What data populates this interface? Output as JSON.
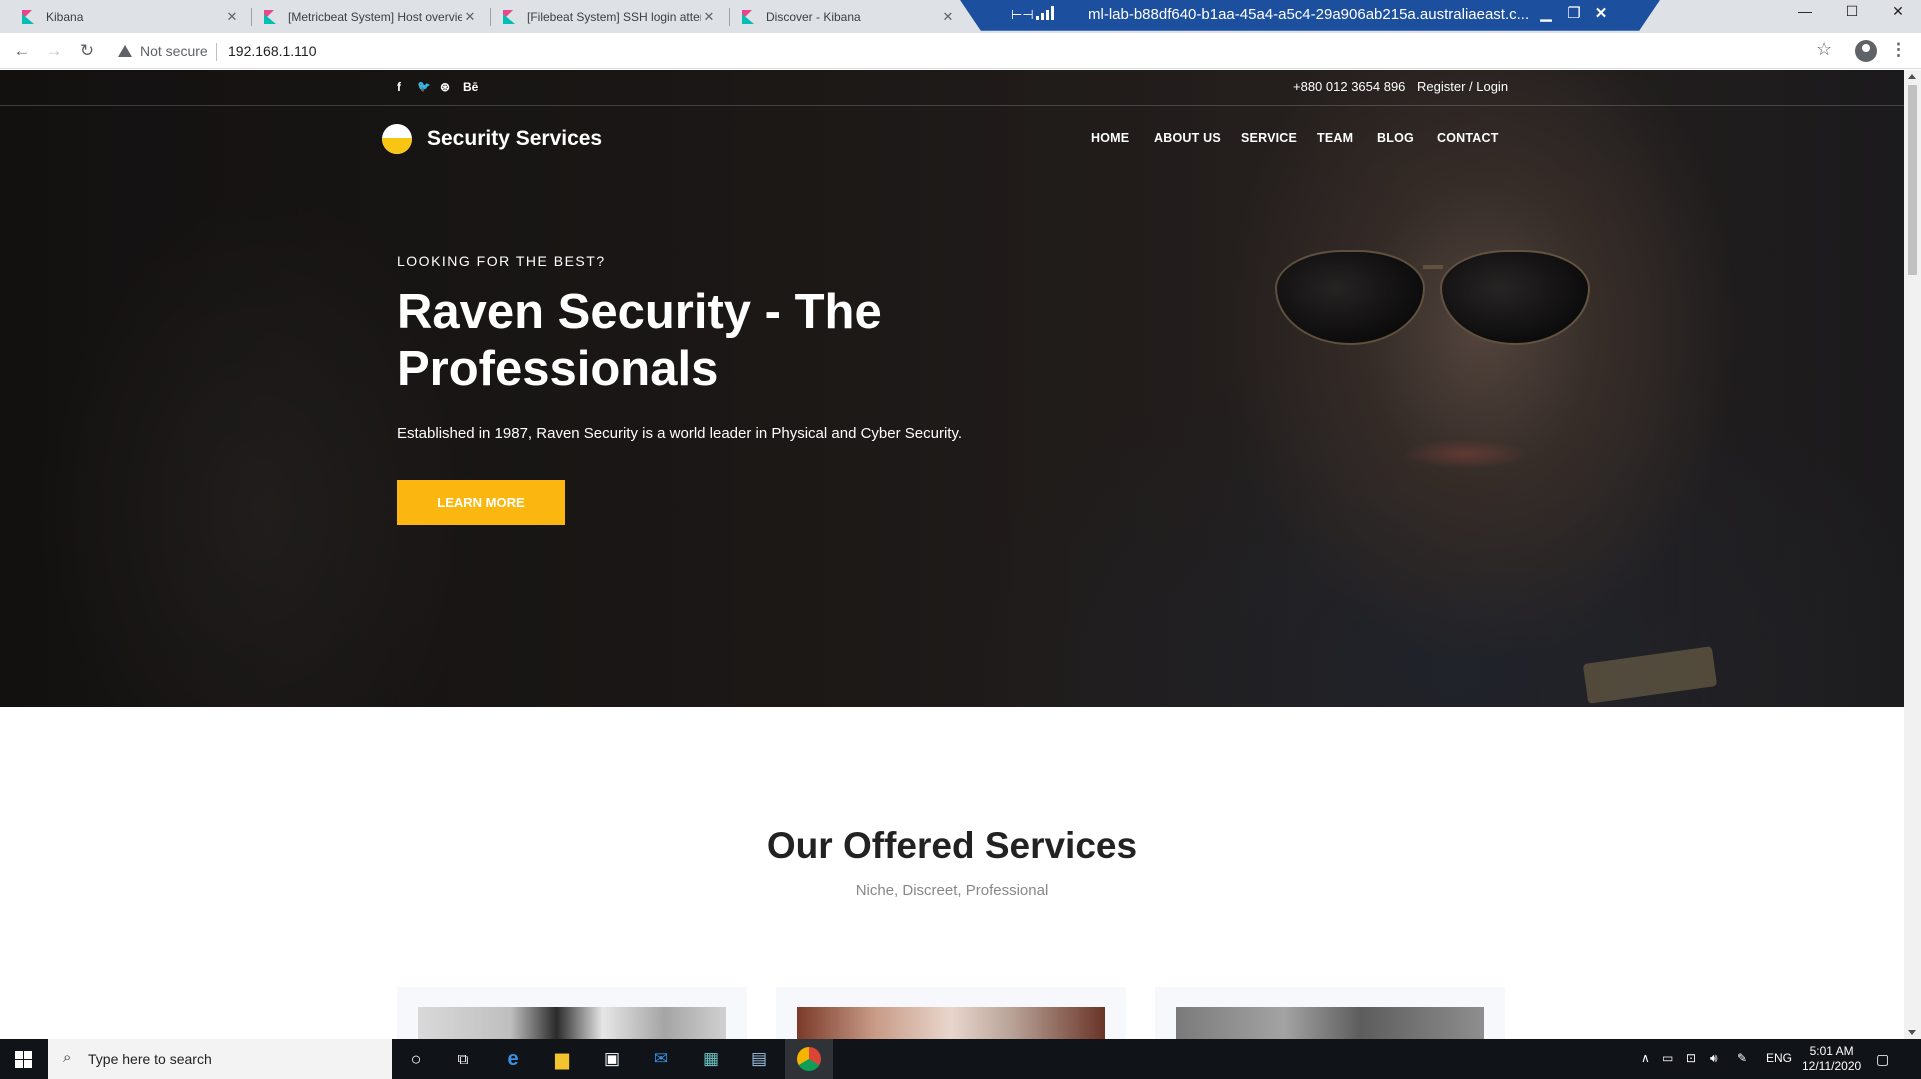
{
  "browser": {
    "tabs": [
      {
        "title": "Kibana"
      },
      {
        "title": "[Metricbeat System] Host overvie"
      },
      {
        "title": "[Filebeat System] SSH login atter"
      },
      {
        "title": "Discover - Kibana"
      }
    ],
    "tab_close": "✕",
    "security_label": "Not secure",
    "url": "192.168.1.110"
  },
  "rdp": {
    "title": "ml-lab-b88df640-b1aa-45a4-a5c4-29a906ab215a.australiaeast.c...",
    "minimize": "▁",
    "restore": "❐",
    "close": "✕"
  },
  "window_controls": {
    "minimize": "—",
    "maximize": "☐",
    "close": "✕"
  },
  "site": {
    "social": [
      "f",
      "🐦",
      "⊛",
      "Bē"
    ],
    "phone": "+880 012 3654 896",
    "register_login": "Register / Login",
    "brand": "Security Services",
    "nav": [
      "HOME",
      "ABOUT US",
      "SERVICE",
      "TEAM",
      "BLOG",
      "CONTACT"
    ],
    "hero": {
      "eyebrow": "LOOKING FOR THE BEST?",
      "title": "Raven Security - The Professionals",
      "subtitle": "Established in 1987, Raven Security is a world leader in Physical and Cyber Security.",
      "cta": "LEARN MORE"
    },
    "services": {
      "title": "Our Offered Services",
      "subtitle": "Niche, Discreet, Professional"
    },
    "accent_color": "#fbb710"
  },
  "taskbar": {
    "search_placeholder": "Type here to search",
    "language": "ENG",
    "time": "5:01 AM",
    "date": "12/11/2020"
  }
}
